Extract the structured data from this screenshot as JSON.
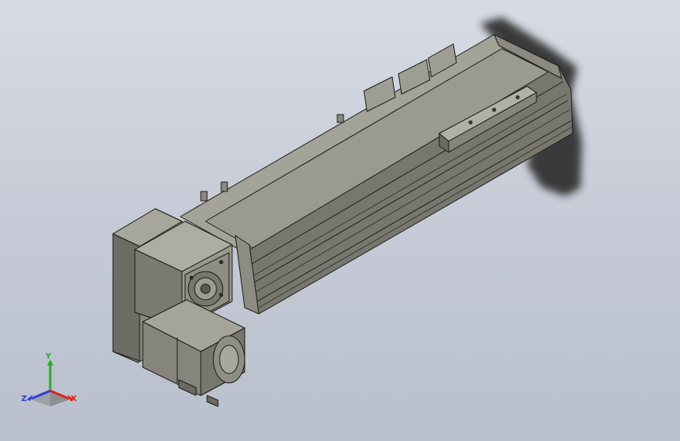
{
  "viewport": {
    "background_top": "#d7dbe4",
    "background_bottom": "#b9bfcc"
  },
  "model": {
    "body_color": "#8b8b82",
    "body_light": "#a8a89d",
    "body_dark": "#5f5f58",
    "rail_color": "#6e6e66",
    "edge_color": "#1c1c1a",
    "shadow_color": "#2a2a2a"
  },
  "triad": {
    "x_label": "X",
    "y_label": "Y",
    "z_label": "Z",
    "x_color": "#e0201c",
    "y_color": "#2fa82f",
    "z_color": "#2a3fd6"
  }
}
